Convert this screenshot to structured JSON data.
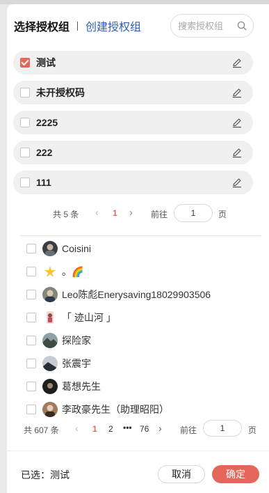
{
  "header": {
    "tab_active": "选择授权组",
    "tab_link": "创建授权组"
  },
  "search": {
    "placeholder": "搜索授权组",
    "value": ""
  },
  "groups": [
    {
      "name": "测试",
      "checked": true
    },
    {
      "name": "未开授权码",
      "checked": false
    },
    {
      "name": "2225",
      "checked": false
    },
    {
      "name": "222",
      "checked": false
    },
    {
      "name": "111",
      "checked": false
    }
  ],
  "group_pager": {
    "total": "共 5 条",
    "prev": "‹",
    "current": "1",
    "next": "›",
    "goto_label": "前往",
    "goto_value": "1",
    "page_unit": "页"
  },
  "users": [
    {
      "name": "Coisini",
      "avatar": "avatar-dark"
    },
    {
      "name": "。🌈",
      "avatar": "avatar-sparkle"
    },
    {
      "name": "Leo陈彪Enerysaving18029903506",
      "avatar": "avatar-photo"
    },
    {
      "name": "「 迹山河 」",
      "avatar": "avatar-figure"
    },
    {
      "name": "探险家",
      "avatar": "avatar-landscape"
    },
    {
      "name": "张震宇",
      "avatar": "avatar-sky"
    },
    {
      "name": "葛想先生",
      "avatar": "avatar-dark"
    },
    {
      "name": "李政豪先生（助理昭阳）",
      "avatar": "avatar-photo"
    }
  ],
  "user_pager": {
    "total": "共 607 条",
    "prev": "‹",
    "page1": "1",
    "page2": "2",
    "dots": "•••",
    "last": "76",
    "next": "›",
    "goto_label": "前往",
    "goto_value": "1",
    "page_unit": "页"
  },
  "footer": {
    "selected_text": "已选：测试",
    "cancel_label": "取消",
    "confirm_label": "确定"
  },
  "colors": {
    "accent": "#e5675c",
    "link": "#2f5fb3",
    "item_bg": "#f0f0f0"
  }
}
